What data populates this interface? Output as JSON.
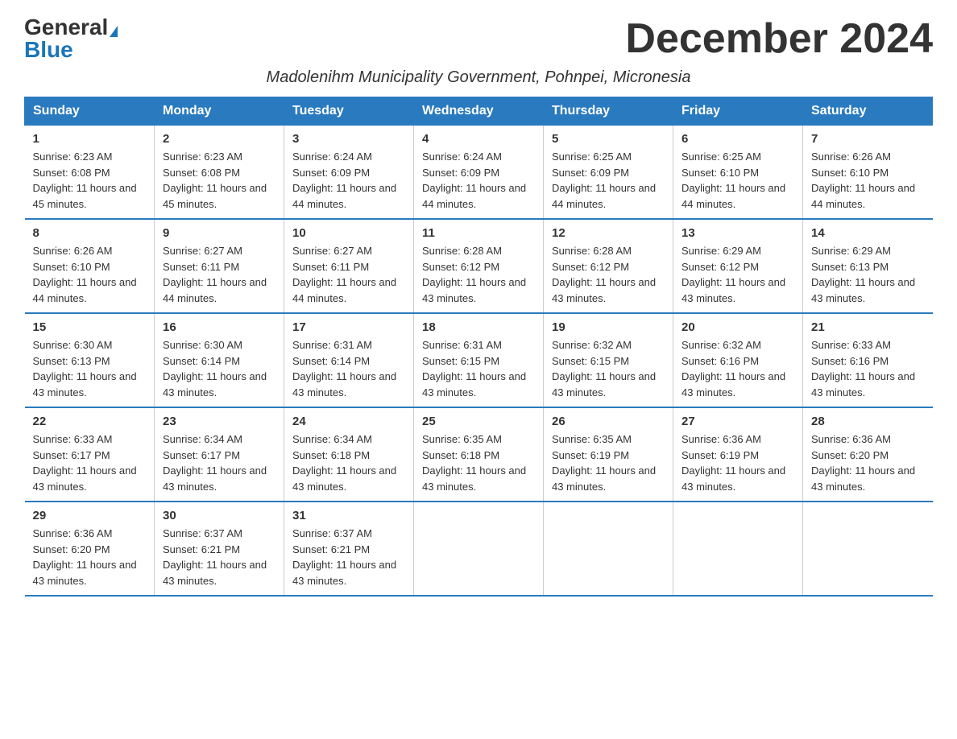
{
  "header": {
    "logo_general": "General",
    "logo_blue": "Blue",
    "title": "December 2024",
    "subtitle": "Madolenihm Municipality Government, Pohnpei, Micronesia"
  },
  "days_of_week": [
    "Sunday",
    "Monday",
    "Tuesday",
    "Wednesday",
    "Thursday",
    "Friday",
    "Saturday"
  ],
  "weeks": [
    [
      {
        "day": "1",
        "sunrise": "6:23 AM",
        "sunset": "6:08 PM",
        "daylight": "11 hours and 45 minutes."
      },
      {
        "day": "2",
        "sunrise": "6:23 AM",
        "sunset": "6:08 PM",
        "daylight": "11 hours and 45 minutes."
      },
      {
        "day": "3",
        "sunrise": "6:24 AM",
        "sunset": "6:09 PM",
        "daylight": "11 hours and 44 minutes."
      },
      {
        "day": "4",
        "sunrise": "6:24 AM",
        "sunset": "6:09 PM",
        "daylight": "11 hours and 44 minutes."
      },
      {
        "day": "5",
        "sunrise": "6:25 AM",
        "sunset": "6:09 PM",
        "daylight": "11 hours and 44 minutes."
      },
      {
        "day": "6",
        "sunrise": "6:25 AM",
        "sunset": "6:10 PM",
        "daylight": "11 hours and 44 minutes."
      },
      {
        "day": "7",
        "sunrise": "6:26 AM",
        "sunset": "6:10 PM",
        "daylight": "11 hours and 44 minutes."
      }
    ],
    [
      {
        "day": "8",
        "sunrise": "6:26 AM",
        "sunset": "6:10 PM",
        "daylight": "11 hours and 44 minutes."
      },
      {
        "day": "9",
        "sunrise": "6:27 AM",
        "sunset": "6:11 PM",
        "daylight": "11 hours and 44 minutes."
      },
      {
        "day": "10",
        "sunrise": "6:27 AM",
        "sunset": "6:11 PM",
        "daylight": "11 hours and 44 minutes."
      },
      {
        "day": "11",
        "sunrise": "6:28 AM",
        "sunset": "6:12 PM",
        "daylight": "11 hours and 43 minutes."
      },
      {
        "day": "12",
        "sunrise": "6:28 AM",
        "sunset": "6:12 PM",
        "daylight": "11 hours and 43 minutes."
      },
      {
        "day": "13",
        "sunrise": "6:29 AM",
        "sunset": "6:12 PM",
        "daylight": "11 hours and 43 minutes."
      },
      {
        "day": "14",
        "sunrise": "6:29 AM",
        "sunset": "6:13 PM",
        "daylight": "11 hours and 43 minutes."
      }
    ],
    [
      {
        "day": "15",
        "sunrise": "6:30 AM",
        "sunset": "6:13 PM",
        "daylight": "11 hours and 43 minutes."
      },
      {
        "day": "16",
        "sunrise": "6:30 AM",
        "sunset": "6:14 PM",
        "daylight": "11 hours and 43 minutes."
      },
      {
        "day": "17",
        "sunrise": "6:31 AM",
        "sunset": "6:14 PM",
        "daylight": "11 hours and 43 minutes."
      },
      {
        "day": "18",
        "sunrise": "6:31 AM",
        "sunset": "6:15 PM",
        "daylight": "11 hours and 43 minutes."
      },
      {
        "day": "19",
        "sunrise": "6:32 AM",
        "sunset": "6:15 PM",
        "daylight": "11 hours and 43 minutes."
      },
      {
        "day": "20",
        "sunrise": "6:32 AM",
        "sunset": "6:16 PM",
        "daylight": "11 hours and 43 minutes."
      },
      {
        "day": "21",
        "sunrise": "6:33 AM",
        "sunset": "6:16 PM",
        "daylight": "11 hours and 43 minutes."
      }
    ],
    [
      {
        "day": "22",
        "sunrise": "6:33 AM",
        "sunset": "6:17 PM",
        "daylight": "11 hours and 43 minutes."
      },
      {
        "day": "23",
        "sunrise": "6:34 AM",
        "sunset": "6:17 PM",
        "daylight": "11 hours and 43 minutes."
      },
      {
        "day": "24",
        "sunrise": "6:34 AM",
        "sunset": "6:18 PM",
        "daylight": "11 hours and 43 minutes."
      },
      {
        "day": "25",
        "sunrise": "6:35 AM",
        "sunset": "6:18 PM",
        "daylight": "11 hours and 43 minutes."
      },
      {
        "day": "26",
        "sunrise": "6:35 AM",
        "sunset": "6:19 PM",
        "daylight": "11 hours and 43 minutes."
      },
      {
        "day": "27",
        "sunrise": "6:36 AM",
        "sunset": "6:19 PM",
        "daylight": "11 hours and 43 minutes."
      },
      {
        "day": "28",
        "sunrise": "6:36 AM",
        "sunset": "6:20 PM",
        "daylight": "11 hours and 43 minutes."
      }
    ],
    [
      {
        "day": "29",
        "sunrise": "6:36 AM",
        "sunset": "6:20 PM",
        "daylight": "11 hours and 43 minutes."
      },
      {
        "day": "30",
        "sunrise": "6:37 AM",
        "sunset": "6:21 PM",
        "daylight": "11 hours and 43 minutes."
      },
      {
        "day": "31",
        "sunrise": "6:37 AM",
        "sunset": "6:21 PM",
        "daylight": "11 hours and 43 minutes."
      },
      null,
      null,
      null,
      null
    ]
  ]
}
